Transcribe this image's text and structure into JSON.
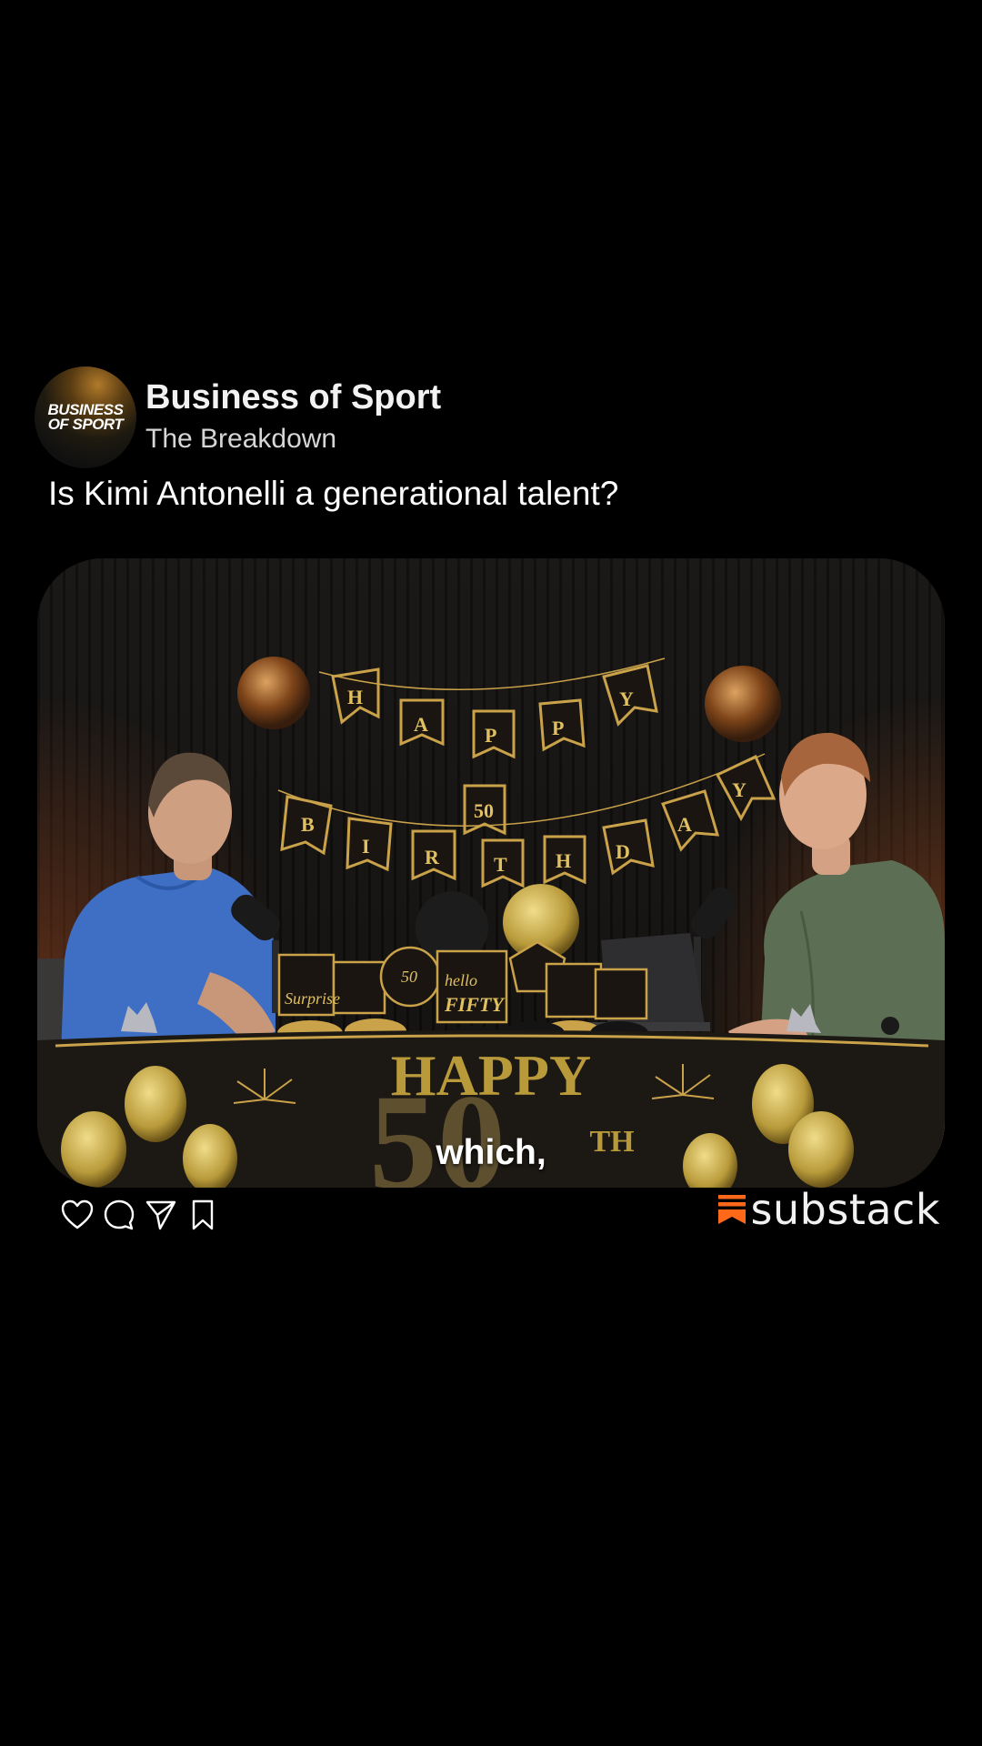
{
  "colors": {
    "background": "#000000",
    "substack_orange": "#FF6719",
    "gold": "#c9a24a"
  },
  "header": {
    "avatar_line1": "BUSINESS",
    "avatar_line2": "OF SPORT",
    "publication_name": "Business of Sport",
    "show_name": "The Breakdown"
  },
  "post": {
    "title": "Is Kimi Antonelli a generational talent?"
  },
  "video": {
    "caption": "which,"
  },
  "actions": {
    "icons": [
      "heart-icon",
      "comment-icon",
      "share-icon",
      "bookmark-icon"
    ]
  },
  "brand": {
    "wordmark": "substack",
    "icon": "substack-logo-icon"
  }
}
